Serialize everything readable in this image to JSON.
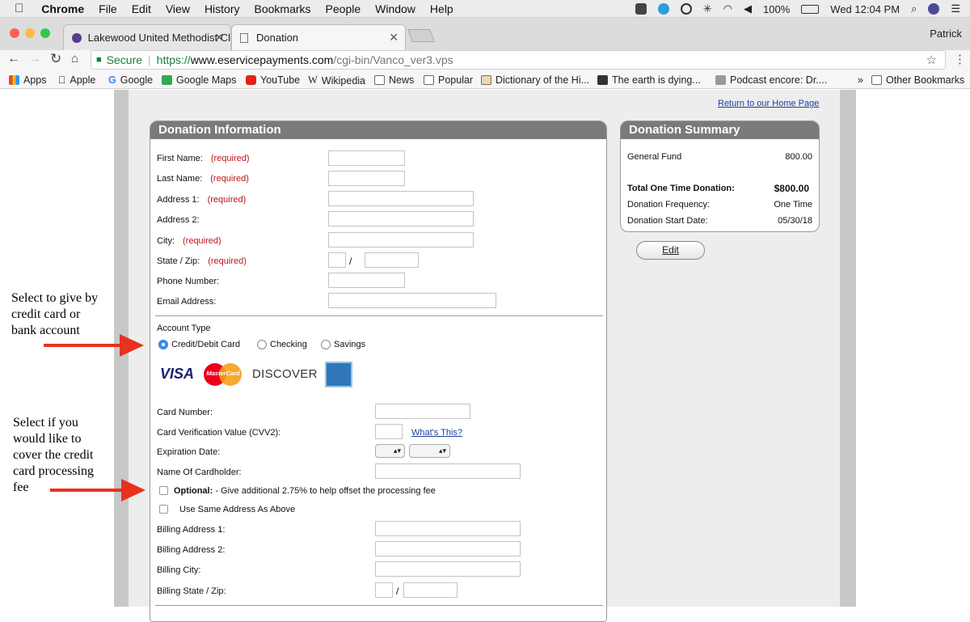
{
  "menubar": {
    "app": "Chrome",
    "items": [
      "File",
      "Edit",
      "View",
      "History",
      "Bookmarks",
      "People",
      "Window",
      "Help"
    ],
    "battery": "100%",
    "clock": "Wed 12:04 PM"
  },
  "tabs": [
    {
      "title": "Lakewood United Methodist Cl"
    },
    {
      "title": "Donation"
    }
  ],
  "profile": "Patrick",
  "address": {
    "secure": "Secure",
    "scheme": "https://",
    "host": "www.eservicepayments.com",
    "path": "/cgi-bin/Vanco_ver3.vps"
  },
  "bookmarks": [
    "Apps",
    "Apple",
    "Google",
    "Google Maps",
    "YouTube",
    "Wikipedia",
    "News",
    "Popular",
    "Dictionary of the Hi...",
    "The earth is dying...",
    "Podcast encore: Dr....",
    "Other Bookmarks"
  ],
  "page": {
    "return_link": "Return to our Home Page",
    "donation_info": {
      "title": "Donation Information",
      "required": "(required)",
      "fields": {
        "first_name": "First Name:",
        "last_name": "Last Name:",
        "address1": "Address 1:",
        "address2": "Address 2:",
        "city": "City:",
        "state_zip": "State / Zip:",
        "phone": "Phone Number:",
        "email": "Email Address:"
      },
      "zip_sep": "/",
      "account_type": "Account Type",
      "options": [
        "Credit/Debit Card",
        "Checking",
        "Savings"
      ],
      "cards": {
        "visa": "VISA",
        "mastercard": "MasterCard",
        "discover": "DISCOVER"
      },
      "card_number": "Card Number:",
      "cvv": "Card Verification Value (CVV2):",
      "whats_this": "What's This?",
      "expiration": "Expiration Date:",
      "cardholder": "Name Of Cardholder:",
      "optional_bold": "Optional:",
      "optional_text": " - Give additional 2.75% to help offset the processing fee",
      "same_address": "Use Same Address As Above",
      "billing1": "Billing Address 1:",
      "billing2": "Billing Address 2:",
      "billing_city": "Billing City:",
      "billing_state": "Billing State / Zip:"
    },
    "summary": {
      "title": "Donation Summary",
      "fund_label": "General Fund",
      "fund_value": "800.00",
      "total_label": "Total One Time Donation:",
      "total_value": "$800.00",
      "freq_label": "Donation Frequency:",
      "freq_value": "One Time",
      "start_label": "Donation Start Date:",
      "start_value": "05/30/18",
      "edit": "Edit"
    }
  },
  "annotations": {
    "one": [
      "Select to give by",
      "credit card or",
      "bank account"
    ],
    "two": [
      "Select if you",
      "would like to",
      "cover the credit",
      "card processing",
      "fee"
    ]
  },
  "colors": {
    "arrow": "#e8321e",
    "required": "#c0141a",
    "panel_head": "#7a7a7a"
  }
}
